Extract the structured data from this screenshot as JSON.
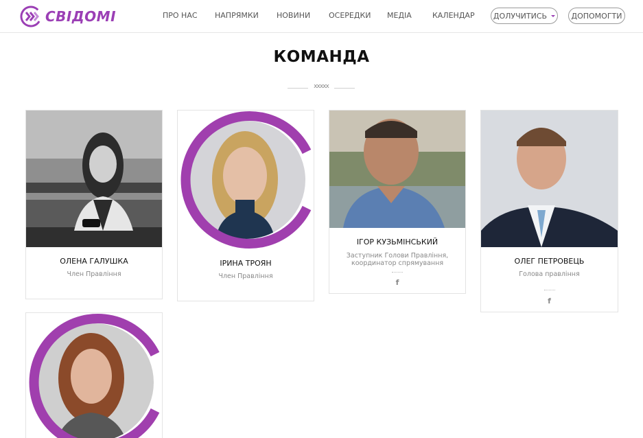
{
  "brand": {
    "name": "СВІДОМІ",
    "color": "#9b3fb5"
  },
  "nav": {
    "items": [
      "ПРО НАС",
      "НАПРЯМКИ",
      "НОВИНИ",
      "ОСЕРЕДКИ",
      "МЕДІА",
      "КАЛЕНДАР"
    ],
    "join_label": "ДОЛУЧИТИСЬ",
    "help_label": "ДОПОМОГТИ"
  },
  "page": {
    "title": "КОМАНДА",
    "divider_marks": "xxxxx"
  },
  "team": [
    {
      "name": "ОЛЕНА ГАЛУШКА",
      "role": "Член Правління",
      "photo_style": "grayscale"
    },
    {
      "name": "ІРИНА ТРОЯН",
      "role": "Член Правління",
      "photo_style": "ring"
    },
    {
      "name": "ІГОР КУЗЬМІНСЬКИЙ",
      "role": "Заступник Голови Правління, координатор спрямування",
      "photo_style": "color",
      "social": "facebook-icon"
    },
    {
      "name": "ОЛЕГ ПЕТРОВЕЦЬ",
      "role": "Голова правління",
      "photo_style": "color",
      "social": "facebook-icon"
    },
    {
      "name": "",
      "role": "",
      "photo_style": "ring"
    }
  ]
}
